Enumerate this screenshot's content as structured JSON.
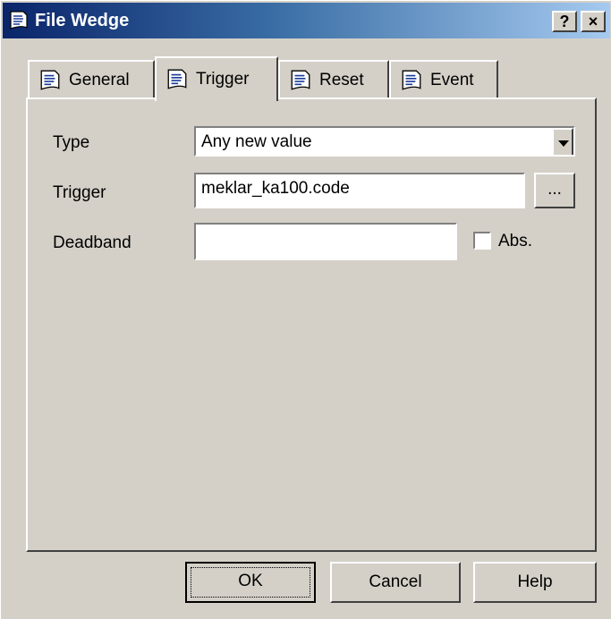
{
  "window": {
    "title": "File Wedge",
    "help_button": "?",
    "close_button": "×"
  },
  "tabs": [
    {
      "label": "General",
      "icon": "document-icon"
    },
    {
      "label": "Trigger",
      "icon": "document-icon",
      "active": true
    },
    {
      "label": "Reset",
      "icon": "document-icon"
    },
    {
      "label": "Event",
      "icon": "document-icon"
    }
  ],
  "form": {
    "type_label": "Type",
    "type_value": "Any new value",
    "trigger_label": "Trigger",
    "trigger_value": "meklar_ka100.code",
    "browse_label": "...",
    "deadband_label": "Deadband",
    "deadband_value": "",
    "abs_label": "Abs.",
    "abs_checked": false
  },
  "buttons": {
    "ok": "OK",
    "cancel": "Cancel",
    "help": "Help"
  }
}
